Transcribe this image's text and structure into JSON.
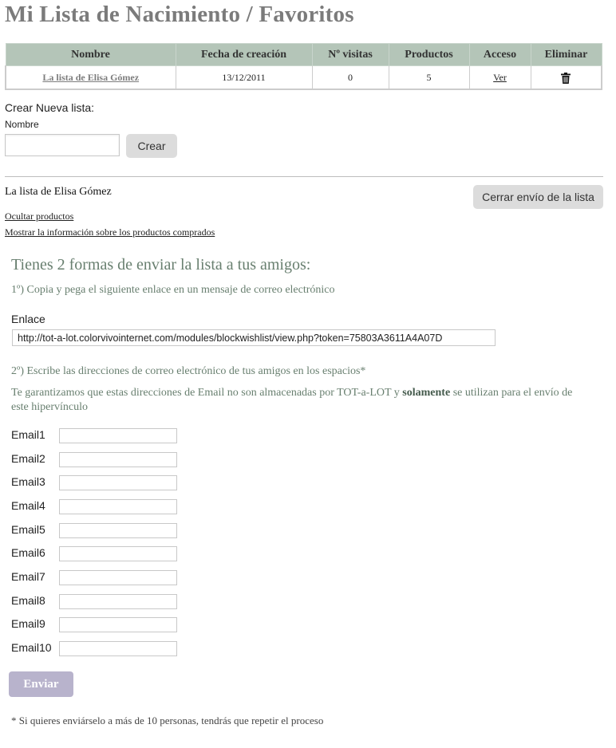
{
  "page_title": "Mi Lista de Nacimiento / Favoritos",
  "table": {
    "headers": [
      "Nombre",
      "Fecha de creación",
      "Nº visitas",
      "Productos",
      "Acceso",
      "Eliminar"
    ],
    "row": {
      "name": "La lista de Elisa Gómez",
      "date": "13/12/2011",
      "visits": "0",
      "products": "5",
      "access": "Ver",
      "delete_icon": "trash-icon"
    }
  },
  "create": {
    "heading": "Crear Nueva lista:",
    "name_label": "Nombre",
    "name_value": "",
    "button": "Crear"
  },
  "selected_list": {
    "title": "La lista de Elisa Gómez",
    "close_button": "Cerrar envío de la lista",
    "hide_products": "Ocultar productos",
    "show_purchased": "Mostrar la información sobre los productos comprados"
  },
  "share": {
    "heading": "Tienes 2 formas de enviar la lista a tus amigos:",
    "step1": "1º) Copia y pega el siguiente enlace en un mensaje de correo electrónico",
    "link_label": "Enlace",
    "link_value": "http://tot-a-lot.colorvivointernet.com/modules/blockwishlist/view.php?token=75803A3611A4A07D",
    "step2": "2º) Escribe las direcciones de correo electrónico de tus amigos en los espacios*",
    "guarantee_pre": "Te garantizamos que estas direcciones de Email no son almacenadas por TOT-a-LOT y ",
    "guarantee_bold": "solamente",
    "guarantee_post": " se utilizan para el envío de este hipervínculo",
    "email_labels": [
      "Email1",
      "Email2",
      "Email3",
      "Email4",
      "Email5",
      "Email6",
      "Email7",
      "Email8",
      "Email9",
      "Email10"
    ],
    "send_button": "Enviar",
    "footnote": "* Si quieres enviárselo a más de 10 personas, tendrás que repetir el proceso"
  },
  "colors": {
    "header_bg": "#b4c5b8",
    "accent_green": "#687f6f",
    "send_button": "#b8b3cc"
  }
}
